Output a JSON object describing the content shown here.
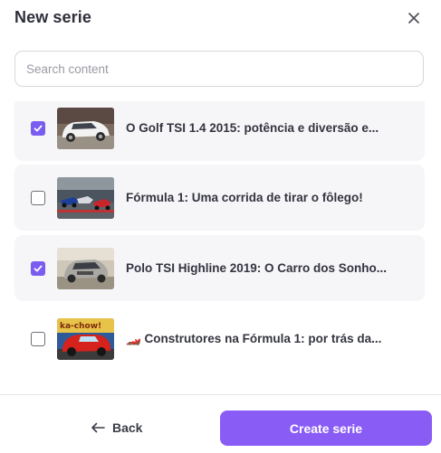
{
  "dialog": {
    "title": "New serie",
    "close_icon": "close-icon"
  },
  "search": {
    "placeholder": "Search content",
    "value": ""
  },
  "items": [
    {
      "title": "O Golf TSI 1.4 2015: potência e diversão e...",
      "checked": true,
      "thumbnail": "white-hatchback-car-photo"
    },
    {
      "title": "Fórmula 1: Uma corrida de tirar o fôlego!",
      "checked": false,
      "thumbnail": "formula-1-race-photo"
    },
    {
      "title": "Polo TSI Highline 2019: O Carro dos Sonho...",
      "checked": true,
      "thumbnail": "silver-polo-car-photo"
    },
    {
      "title": "🏎️ Construtores na Fórmula 1: por trás da...",
      "checked": false,
      "thumbnail": "cartoon-race-car-kachow"
    }
  ],
  "footer": {
    "back_label": "Back",
    "create_label": "Create serie"
  },
  "colors": {
    "accent": "#8a5cf6",
    "checkbox_checked": "#7b5cf0",
    "row_shaded": "#f6f5f8"
  }
}
